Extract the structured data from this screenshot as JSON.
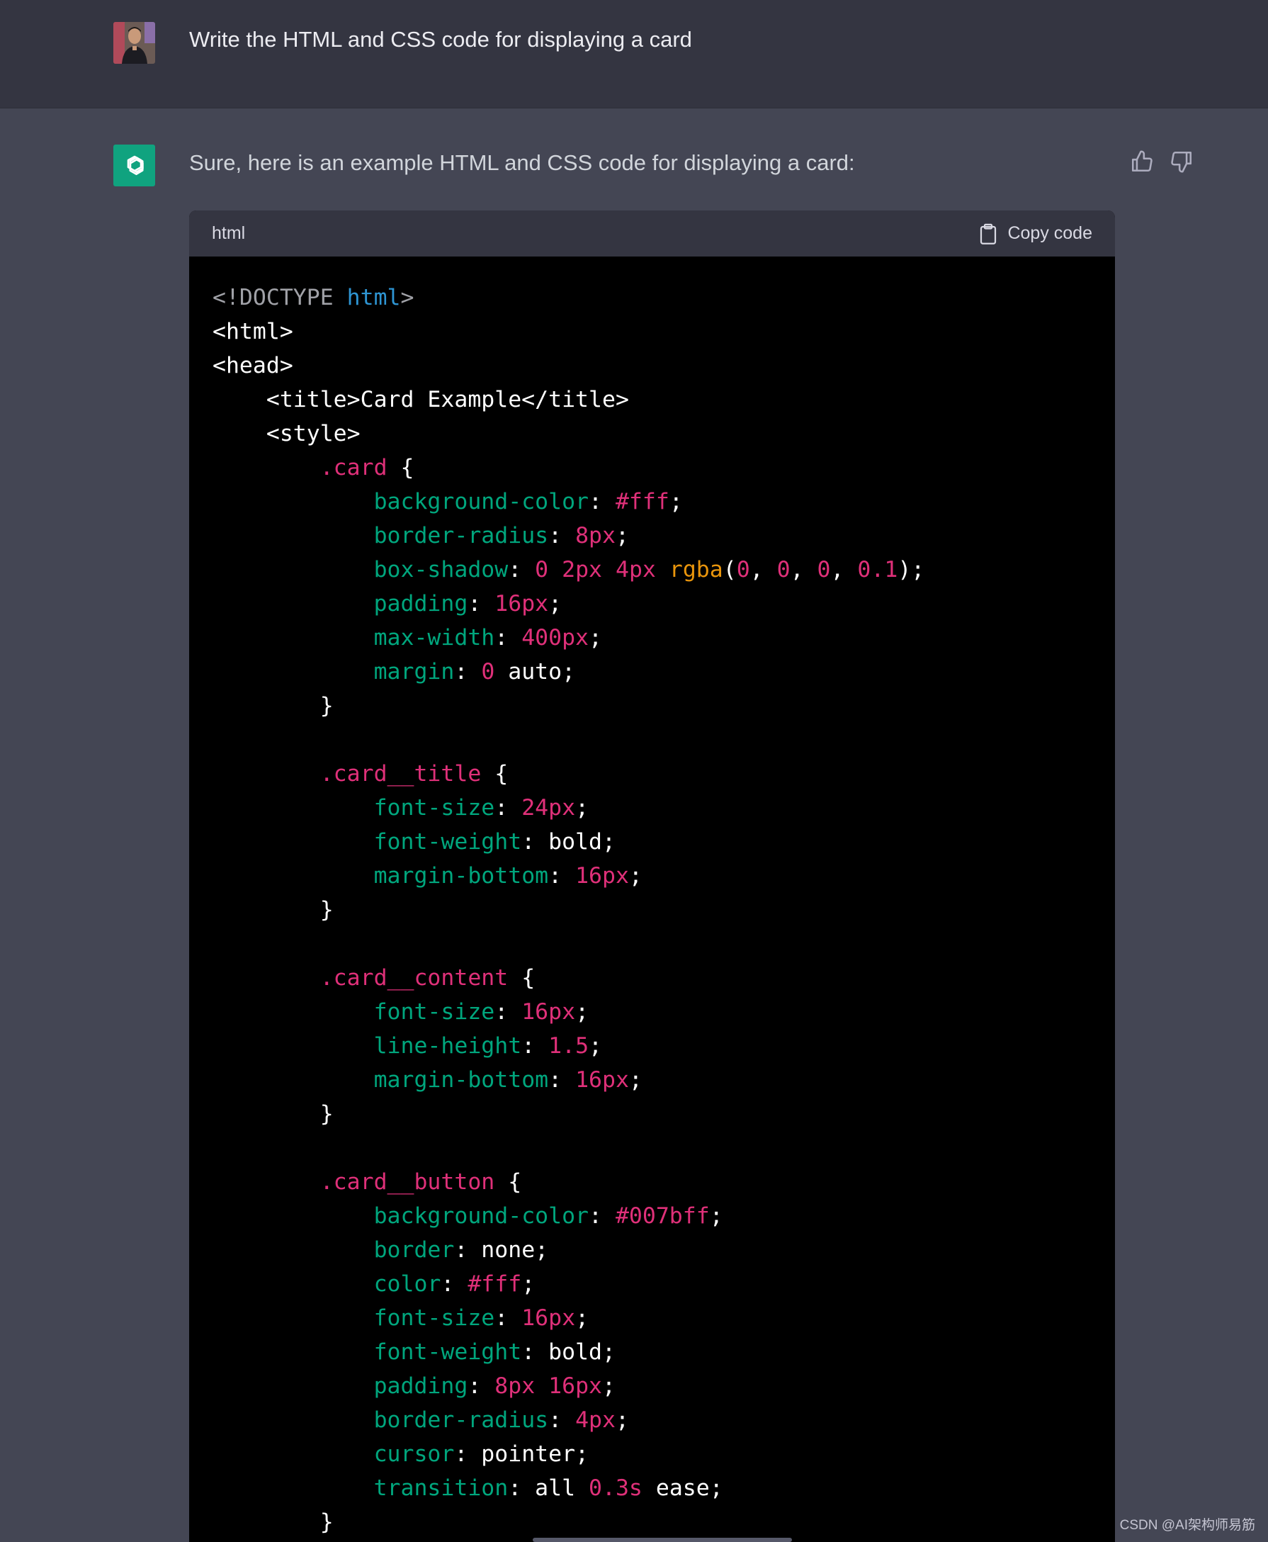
{
  "user_message": {
    "avatar": "user-photo",
    "text": "Write the HTML and CSS code for displaying a card"
  },
  "assistant_message": {
    "avatar": "openai-logo-icon",
    "intro": "Sure, here is an example HTML and CSS code for displaying a card:",
    "feedback": {
      "up_icon": "thumbs-up-icon",
      "down_icon": "thumbs-down-icon"
    }
  },
  "code_block": {
    "language": "html",
    "copy_label": "Copy code",
    "lines": [
      [
        [
          "doctype",
          "<!DOCTYPE "
        ],
        [
          "kw",
          "html"
        ],
        [
          "doctype",
          ">"
        ]
      ],
      [
        [
          "punc",
          "<html>"
        ]
      ],
      [
        [
          "punc",
          "<head>"
        ]
      ],
      [
        [
          "plain",
          "    "
        ],
        [
          "punc",
          "<title>Card Example</title>"
        ]
      ],
      [
        [
          "plain",
          "    "
        ],
        [
          "punc",
          "<style>"
        ]
      ],
      [
        [
          "plain",
          "        "
        ],
        [
          "sel",
          ".card"
        ],
        [
          "punc",
          " {"
        ]
      ],
      [
        [
          "plain",
          "            "
        ],
        [
          "prop",
          "background-color"
        ],
        [
          "punc",
          ": "
        ],
        [
          "num",
          "#fff"
        ],
        [
          "punc",
          ";"
        ]
      ],
      [
        [
          "plain",
          "            "
        ],
        [
          "prop",
          "border-radius"
        ],
        [
          "punc",
          ": "
        ],
        [
          "num",
          "8px"
        ],
        [
          "punc",
          ";"
        ]
      ],
      [
        [
          "plain",
          "            "
        ],
        [
          "prop",
          "box-shadow"
        ],
        [
          "punc",
          ": "
        ],
        [
          "num",
          "0"
        ],
        [
          "punc",
          " "
        ],
        [
          "num",
          "2px"
        ],
        [
          "punc",
          " "
        ],
        [
          "num",
          "4px"
        ],
        [
          "punc",
          " "
        ],
        [
          "fn",
          "rgba"
        ],
        [
          "punc",
          "("
        ],
        [
          "num",
          "0"
        ],
        [
          "punc",
          ", "
        ],
        [
          "num",
          "0"
        ],
        [
          "punc",
          ", "
        ],
        [
          "num",
          "0"
        ],
        [
          "punc",
          ", "
        ],
        [
          "num",
          "0.1"
        ],
        [
          "punc",
          ");"
        ]
      ],
      [
        [
          "plain",
          "            "
        ],
        [
          "prop",
          "padding"
        ],
        [
          "punc",
          ": "
        ],
        [
          "num",
          "16px"
        ],
        [
          "punc",
          ";"
        ]
      ],
      [
        [
          "plain",
          "            "
        ],
        [
          "prop",
          "max-width"
        ],
        [
          "punc",
          ": "
        ],
        [
          "num",
          "400px"
        ],
        [
          "punc",
          ";"
        ]
      ],
      [
        [
          "plain",
          "            "
        ],
        [
          "prop",
          "margin"
        ],
        [
          "punc",
          ": "
        ],
        [
          "num",
          "0"
        ],
        [
          "punc",
          " auto;"
        ]
      ],
      [
        [
          "plain",
          "        "
        ],
        [
          "punc",
          "}"
        ]
      ],
      [
        [
          "plain",
          ""
        ]
      ],
      [
        [
          "plain",
          "        "
        ],
        [
          "sel",
          ".card__title"
        ],
        [
          "punc",
          " {"
        ]
      ],
      [
        [
          "plain",
          "            "
        ],
        [
          "prop",
          "font-size"
        ],
        [
          "punc",
          ": "
        ],
        [
          "num",
          "24px"
        ],
        [
          "punc",
          ";"
        ]
      ],
      [
        [
          "plain",
          "            "
        ],
        [
          "prop",
          "font-weight"
        ],
        [
          "punc",
          ": bold;"
        ]
      ],
      [
        [
          "plain",
          "            "
        ],
        [
          "prop",
          "margin-bottom"
        ],
        [
          "punc",
          ": "
        ],
        [
          "num",
          "16px"
        ],
        [
          "punc",
          ";"
        ]
      ],
      [
        [
          "plain",
          "        "
        ],
        [
          "punc",
          "}"
        ]
      ],
      [
        [
          "plain",
          ""
        ]
      ],
      [
        [
          "plain",
          "        "
        ],
        [
          "sel",
          ".card__content"
        ],
        [
          "punc",
          " {"
        ]
      ],
      [
        [
          "plain",
          "            "
        ],
        [
          "prop",
          "font-size"
        ],
        [
          "punc",
          ": "
        ],
        [
          "num",
          "16px"
        ],
        [
          "punc",
          ";"
        ]
      ],
      [
        [
          "plain",
          "            "
        ],
        [
          "prop",
          "line-height"
        ],
        [
          "punc",
          ": "
        ],
        [
          "num",
          "1.5"
        ],
        [
          "punc",
          ";"
        ]
      ],
      [
        [
          "plain",
          "            "
        ],
        [
          "prop",
          "margin-bottom"
        ],
        [
          "punc",
          ": "
        ],
        [
          "num",
          "16px"
        ],
        [
          "punc",
          ";"
        ]
      ],
      [
        [
          "plain",
          "        "
        ],
        [
          "punc",
          "}"
        ]
      ],
      [
        [
          "plain",
          ""
        ]
      ],
      [
        [
          "plain",
          "        "
        ],
        [
          "sel",
          ".card__button"
        ],
        [
          "punc",
          " {"
        ]
      ],
      [
        [
          "plain",
          "            "
        ],
        [
          "prop",
          "background-color"
        ],
        [
          "punc",
          ": "
        ],
        [
          "num",
          "#007bff"
        ],
        [
          "punc",
          ";"
        ]
      ],
      [
        [
          "plain",
          "            "
        ],
        [
          "prop",
          "border"
        ],
        [
          "punc",
          ": none;"
        ]
      ],
      [
        [
          "plain",
          "            "
        ],
        [
          "prop",
          "color"
        ],
        [
          "punc",
          ": "
        ],
        [
          "num",
          "#fff"
        ],
        [
          "punc",
          ";"
        ]
      ],
      [
        [
          "plain",
          "            "
        ],
        [
          "prop",
          "font-size"
        ],
        [
          "punc",
          ": "
        ],
        [
          "num",
          "16px"
        ],
        [
          "punc",
          ";"
        ]
      ],
      [
        [
          "plain",
          "            "
        ],
        [
          "prop",
          "font-weight"
        ],
        [
          "punc",
          ": bold;"
        ]
      ],
      [
        [
          "plain",
          "            "
        ],
        [
          "prop",
          "padding"
        ],
        [
          "punc",
          ": "
        ],
        [
          "num",
          "8px"
        ],
        [
          "punc",
          " "
        ],
        [
          "num",
          "16px"
        ],
        [
          "punc",
          ";"
        ]
      ],
      [
        [
          "plain",
          "            "
        ],
        [
          "prop",
          "border-radius"
        ],
        [
          "punc",
          ": "
        ],
        [
          "num",
          "4px"
        ],
        [
          "punc",
          ";"
        ]
      ],
      [
        [
          "plain",
          "            "
        ],
        [
          "prop",
          "cursor"
        ],
        [
          "punc",
          ": pointer;"
        ]
      ],
      [
        [
          "plain",
          "            "
        ],
        [
          "prop",
          "transition"
        ],
        [
          "punc",
          ": all "
        ],
        [
          "num",
          "0.3s"
        ],
        [
          "punc",
          " ease;"
        ]
      ],
      [
        [
          "plain",
          "        "
        ],
        [
          "punc",
          "}"
        ]
      ]
    ]
  },
  "watermark": "CSDN @AI架构师易筋",
  "colors": {
    "page_bg": "#444654",
    "user_row_bg": "#343541",
    "code_bg": "#000000",
    "selector": "#df3079",
    "property": "#00a67d",
    "keyword": "#2e95d3",
    "function": "#e9950c",
    "brand_green": "#10a37f"
  }
}
